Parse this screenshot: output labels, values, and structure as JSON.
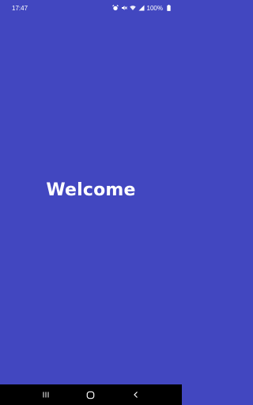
{
  "status_bar": {
    "time": "17:47",
    "battery": "100%",
    "icons": [
      "alarm-icon",
      "mute-icon",
      "wifi-icon",
      "signal-icon",
      "battery-icon"
    ]
  },
  "main": {
    "title": "Welcome"
  },
  "colors": {
    "background": "#4247c0",
    "text": "#ffffff",
    "nav_bar": "#000000"
  },
  "nav_bar": {
    "icons": [
      "recent-apps-icon",
      "home-icon",
      "back-icon"
    ]
  }
}
